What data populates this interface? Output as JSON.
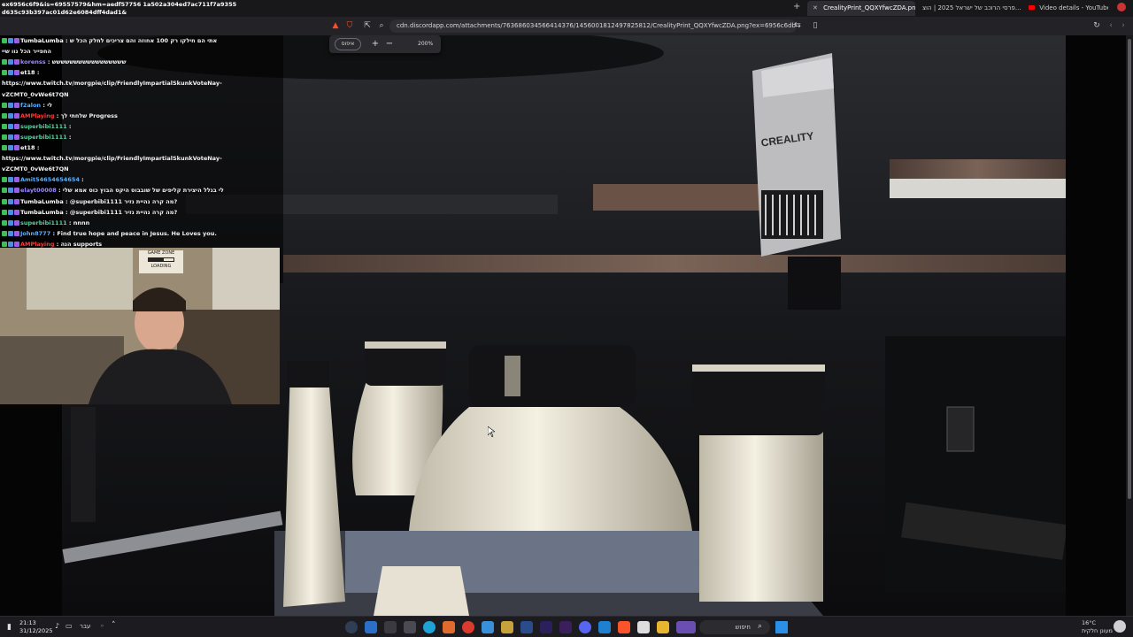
{
  "browser": {
    "window_title": "ex6956c6f9&is=69557579&hm=aedf57756 1a502a304ed7ac711f7a9355 d635c93b397ac01d62e6084dff4dad1&",
    "window_title_line1": "ex6956c6f9&is=69557579&hm=aedf57756 1a502a304ed7ac711f7a9355",
    "window_title_line2": "d635c93b397ac01d62e6084dff4dad1&",
    "tabs": [
      {
        "label": "CrealityPrint_QQXYfwcZDA.png",
        "active": true
      },
      {
        "label": "פרסי הרוכב של ישראל 2025 | הוצ...",
        "active": false
      },
      {
        "label": "Video details - YouTube Studio",
        "active": false
      }
    ],
    "new_tab_label": "+",
    "url": "cdn.discordapp.com/attachments/763686034566414376/1456001812497825812/CrealityPrint_QQXYfwcZDA.png?ex=6956c6db&is=6955755b...",
    "zoom": {
      "reset_label": "איפוס",
      "plus_label": "+",
      "minus_label": "−",
      "level": "200%"
    }
  },
  "chat": {
    "header_line1": "אתי הם חילקו רק 100 אחוזה והם צריכים לחלק הכל ש",
    "header_line2": "החפייר הכל נוו שיי",
    "messages": [
      {
        "user": "TumbaLumba",
        "user_color": "#ffffff",
        "text": " : אתי הם חילקו רק 100 אחוזה והם צריכים לחלק הכל ש"
      },
      {
        "user": "",
        "user_color": "#ffffff",
        "text": "החפייר הכל נוו שיי"
      },
      {
        "user": "korenss",
        "user_color": "#9b8cff",
        "text": " : ששששששששששששששששש"
      },
      {
        "user": "et18",
        "user_color": "#ffffff",
        "text": " :"
      },
      {
        "user": "",
        "user_color": "#ffffff",
        "text": "https://www.twitch.tv/morgpie/clip/FriendlyImpartialSkunkVoteNay-"
      },
      {
        "user": "",
        "user_color": "#ffffff",
        "text": "vZCMT0_0vWe6t7QN"
      },
      {
        "user": "f2alon",
        "user_color": "#5ab0ff",
        "text": " : לי"
      },
      {
        "user": "AMPlaying",
        "user_color": "#ff3b3b",
        "text": " : שלחתי לך Progress"
      },
      {
        "user": "superbibi1111",
        "user_color": "#5ad0a0",
        "text": " : "
      },
      {
        "user": "superbibi1111",
        "user_color": "#5ad0a0",
        "text": " : "
      },
      {
        "user": "et18",
        "user_color": "#ffffff",
        "text": " :"
      },
      {
        "user": "",
        "user_color": "#ffffff",
        "text": "https://www.twitch.tv/morgpie/clip/FriendlyImpartialSkunkVoteNay-"
      },
      {
        "user": "",
        "user_color": "#ffffff",
        "text": "vZCMT0_0vWe6t7QN"
      },
      {
        "user": "Amit54654654654",
        "user_color": "#5ab0ff",
        "text": " : "
      },
      {
        "user": "elayt00008",
        "user_color": "#9b8cff",
        "text": " : לי בגלל היצירת קליפים של שובבוס היקס הבוץ כוס אמא שלי"
      },
      {
        "user": "TumbaLumba",
        "user_color": "#ffffff",
        "text": " : @superbibi1111 מה קרה נהיית נזיר?"
      },
      {
        "user": "TumbaLumba",
        "user_color": "#ffffff",
        "text": " : @superbibi1111 מה קרה נהיית נזיר?"
      },
      {
        "user": "superbibi1111",
        "user_color": "#5ad0a0",
        "text": " : nnnn"
      },
      {
        "user": "John8777",
        "user_color": "#5ab0ff",
        "text": " : Find true hope and peace in Jesus. He Loves you."
      },
      {
        "user": "AMPlaying",
        "user_color": "#ff3b3b",
        "text": " : הנה supports"
      }
    ]
  },
  "webcam": {
    "sign_line1": "GAME ZONE",
    "sign_line2": "LOADING"
  },
  "photo": {
    "brand_text": "CREALITY"
  },
  "taskbar": {
    "time": "21:13",
    "date": "31/12/2025",
    "language": "עבר",
    "search_placeholder": "חיפוש",
    "weather_temp": "16°C",
    "weather_condition": "מעונן חלקית"
  }
}
